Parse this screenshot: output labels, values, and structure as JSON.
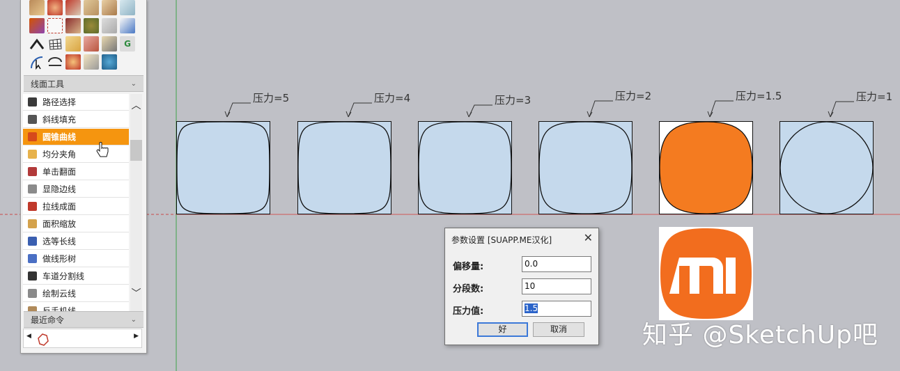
{
  "toolbar": {
    "section_line_tools": "线面工具",
    "section_recent": "最近命令",
    "items": [
      {
        "label": "路径选择",
        "icon": "path-select-icon",
        "color": "#3a3a3a"
      },
      {
        "label": "斜线填充",
        "icon": "hatch-fill-icon",
        "color": "#555555"
      },
      {
        "label": "圆锥曲线",
        "icon": "conic-curve-icon",
        "color": "#d64a1b"
      },
      {
        "label": "均分夹角",
        "icon": "bisect-angle-icon",
        "color": "#e7b24c"
      },
      {
        "label": "单击翻面",
        "icon": "flip-face-icon",
        "color": "#b23a3a"
      },
      {
        "label": "显隐边线",
        "icon": "toggle-edges-icon",
        "color": "#8b8b8b"
      },
      {
        "label": "拉线成面",
        "icon": "extrude-line-icon",
        "color": "#c0392b"
      },
      {
        "label": "面积缩放",
        "icon": "area-scale-icon",
        "color": "#d4a24c"
      },
      {
        "label": "选等长线",
        "icon": "equal-length-icon",
        "color": "#3a5fb0"
      },
      {
        "label": "做线形树",
        "icon": "line-tree-icon",
        "color": "#4a6fc4"
      },
      {
        "label": "车道分割线",
        "icon": "lane-divider-icon",
        "color": "#333333"
      },
      {
        "label": "绘制云线",
        "icon": "cloud-line-icon",
        "color": "#8a8a8a"
      },
      {
        "label": "反手机线",
        "icon": "reverse-line-icon",
        "color": "#b08a5a"
      }
    ],
    "selected_index": 2
  },
  "shapes": [
    {
      "label": "压力=5",
      "fill": "#c5d9ec"
    },
    {
      "label": "压力=4",
      "fill": "#c5d9ec"
    },
    {
      "label": "压力=3",
      "fill": "#c5d9ec"
    },
    {
      "label": "压力=2",
      "fill": "#c5d9ec"
    },
    {
      "label": "压力=1.5",
      "fill": "#f47b20"
    },
    {
      "label": "压力=1",
      "fill": "#c5d9ec"
    }
  ],
  "dialog": {
    "title": "参数设置 [SUAPP.ME汉化]",
    "fields": [
      {
        "label": "偏移量:",
        "value": "0.0"
      },
      {
        "label": "分段数:",
        "value": "10"
      },
      {
        "label": "压力值:",
        "value": "1.5"
      }
    ],
    "ok": "好",
    "cancel": "取消"
  },
  "logo": {
    "text": "MI",
    "color": "#f26d1e"
  },
  "watermark": "知乎 @SketchUp吧",
  "colors": {
    "viewport_bg": "#bfc0c6",
    "accent": "#f5950f",
    "shape_fill": "#c5d9ec",
    "orange_fill": "#f47b20"
  }
}
